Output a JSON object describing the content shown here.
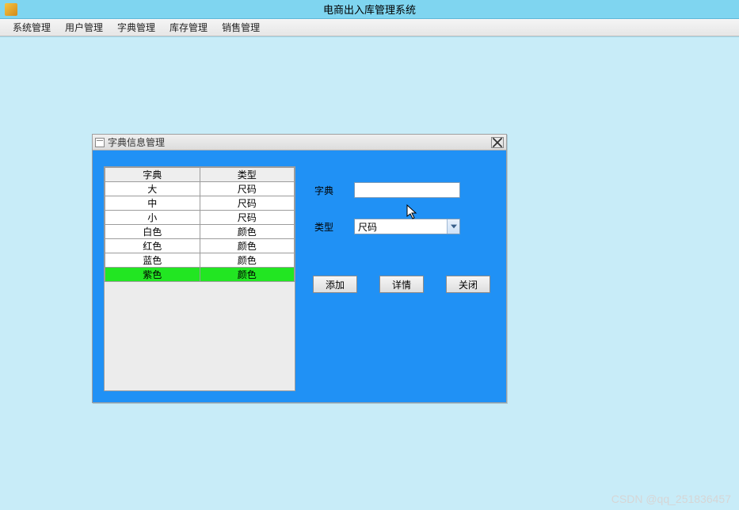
{
  "app_title": "电商出入库管理系统",
  "menu": [
    "系统管理",
    "用户管理",
    "字典管理",
    "库存管理",
    "销售管理"
  ],
  "dialog": {
    "title": "字典信息管理",
    "table": {
      "headers": [
        "字典",
        "类型"
      ],
      "rows": [
        {
          "dict": "大",
          "type": "尺码",
          "selected": false
        },
        {
          "dict": "中",
          "type": "尺码",
          "selected": false
        },
        {
          "dict": "小",
          "type": "尺码",
          "selected": false
        },
        {
          "dict": "白色",
          "type": "颜色",
          "selected": false
        },
        {
          "dict": "红色",
          "type": "颜色",
          "selected": false
        },
        {
          "dict": "蓝色",
          "type": "颜色",
          "selected": false
        },
        {
          "dict": "紫色",
          "type": "颜色",
          "selected": true
        }
      ]
    },
    "form": {
      "dict_label": "字典",
      "dict_value": "",
      "type_label": "类型",
      "type_value": "尺码"
    },
    "buttons": {
      "add": "添加",
      "detail": "详情",
      "close": "关闭"
    }
  },
  "watermark": "CSDN @qq_251836457"
}
